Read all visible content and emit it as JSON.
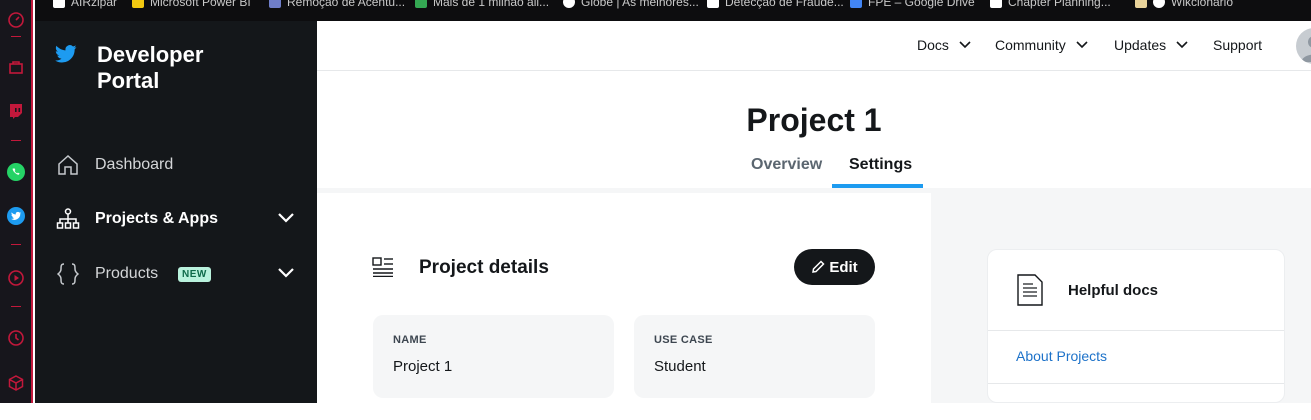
{
  "browser": {
    "bookmarks": [
      {
        "label": "AIRzipar",
        "color": "#ffffff"
      },
      {
        "label": "Microsoft Power BI",
        "color": "#f2c811"
      },
      {
        "label": "Remoção de Acentu...",
        "color": "#6f7ec9"
      },
      {
        "label": "Mais de 1 milhão all...",
        "color": "#34a853"
      },
      {
        "label": "Globe | As melhores...",
        "color": "#ffffff"
      },
      {
        "label": "Detecção de Fraude...",
        "color": "#ffffff"
      },
      {
        "label": "FPE – Google Drive",
        "color": "#4285f4"
      },
      {
        "label": "Chapter Planning...",
        "color": "#ffffff"
      },
      {
        "label": "Wikcionário",
        "color": "#ffffff"
      }
    ]
  },
  "sidebar": {
    "brand_line1": "Developer",
    "brand_line2": "Portal",
    "items": [
      {
        "label": "Dashboard"
      },
      {
        "label": "Projects & Apps"
      },
      {
        "label": "Products",
        "badge": "NEW"
      }
    ]
  },
  "topnav": {
    "items": [
      {
        "label": "Docs"
      },
      {
        "label": "Community"
      },
      {
        "label": "Updates"
      },
      {
        "label": "Support"
      }
    ]
  },
  "page": {
    "title": "Project 1",
    "tabs": [
      {
        "label": "Overview"
      },
      {
        "label": "Settings"
      }
    ],
    "active_tab": "Settings"
  },
  "details": {
    "title": "Project details",
    "edit_label": "Edit",
    "fields": [
      {
        "label": "NAME",
        "value": "Project 1"
      },
      {
        "label": "USE CASE",
        "value": "Student"
      }
    ]
  },
  "docs": {
    "title": "Helpful docs",
    "links": [
      "About Projects"
    ]
  },
  "colors": {
    "accent": "#1d9bf0",
    "sidebar_bg": "#14171a",
    "rail_accent": "#c2183b"
  }
}
